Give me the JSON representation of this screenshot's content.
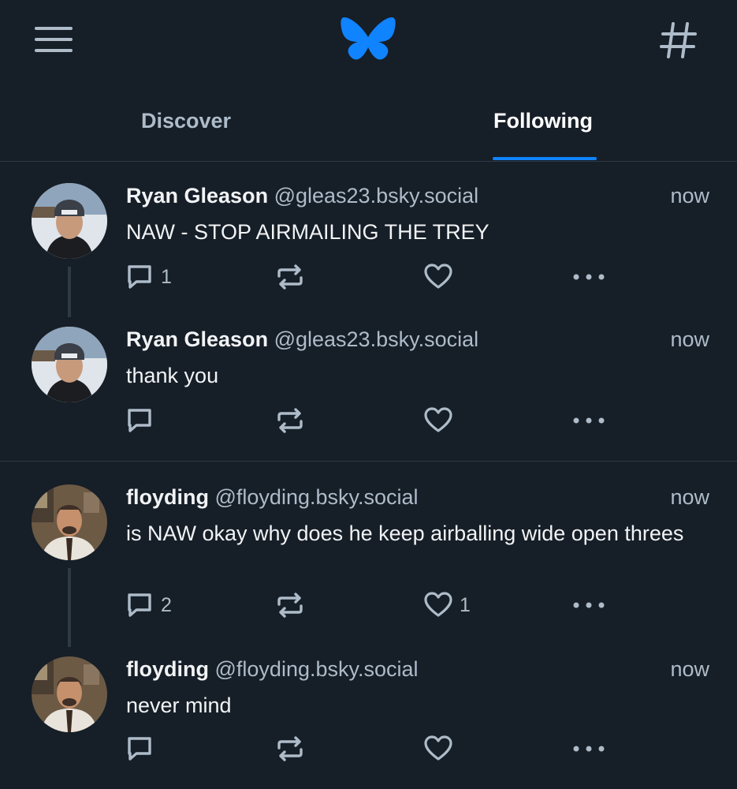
{
  "header": {
    "menu_icon": "hamburger-menu-icon",
    "logo_icon": "butterfly-logo-icon",
    "feeds_icon": "hashtag-icon",
    "brand_color": "#1083fe"
  },
  "tabs": [
    {
      "label": "Discover",
      "active": false
    },
    {
      "label": "Following",
      "active": true
    }
  ],
  "posts": [
    {
      "author": "Ryan Gleason",
      "handle": "@gleas23.bsky.social",
      "time": "now",
      "text": "NAW - STOP AIRMAILING THE TREY",
      "replies": "1",
      "reposts": "",
      "likes": ""
    },
    {
      "author": "Ryan Gleason",
      "handle": "@gleas23.bsky.social",
      "time": "now",
      "text": "thank you",
      "replies": "",
      "reposts": "",
      "likes": ""
    },
    {
      "author": "floyding",
      "handle": "@floyding.bsky.social",
      "time": "now",
      "text": "is NAW okay why does he keep airballing wide open threes",
      "replies": "2",
      "reposts": "",
      "likes": "1"
    },
    {
      "author": "floyding",
      "handle": "@floyding.bsky.social",
      "time": "now",
      "text": "never mind",
      "replies": "",
      "reposts": "",
      "likes": ""
    }
  ],
  "colors": {
    "background": "#161e27",
    "muted_text": "#aebbc9",
    "divider": "#2e3a46",
    "accent": "#1083fe"
  }
}
